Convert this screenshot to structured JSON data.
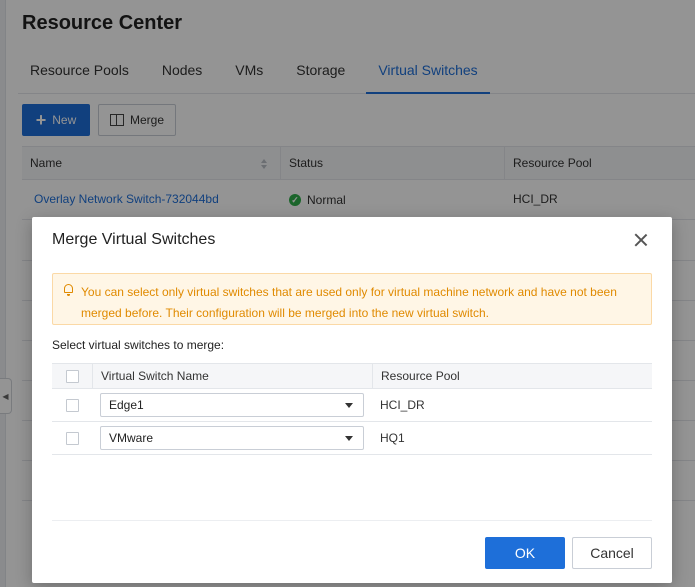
{
  "page": {
    "title": "Resource Center",
    "tabs": [
      {
        "label": "Resource Pools",
        "active": false
      },
      {
        "label": "Nodes",
        "active": false
      },
      {
        "label": "VMs",
        "active": false
      },
      {
        "label": "Storage",
        "active": false
      },
      {
        "label": "Virtual Switches",
        "active": true
      }
    ],
    "toolbar": {
      "new_label": "New",
      "merge_label": "Merge"
    },
    "table": {
      "columns": [
        "Name",
        "Status",
        "Resource Pool"
      ],
      "rows": [
        {
          "name": "Overlay Network Switch-732044bd",
          "status": "Normal",
          "pool": "HCI_DR"
        }
      ]
    }
  },
  "dialog": {
    "title": "Merge Virtual Switches",
    "notice": "You can select only virtual switches that are used only for virtual machine network and have not been merged before. Their configuration will be merged into the new virtual switch.",
    "select_label": "Select virtual switches to merge:",
    "columns": [
      "Virtual Switch Name",
      "Resource Pool"
    ],
    "rows": [
      {
        "switch": "Edge1",
        "pool": "HCI_DR",
        "checked": false
      },
      {
        "switch": "VMware",
        "pool": "HQ1",
        "checked": false
      }
    ],
    "ok_label": "OK",
    "cancel_label": "Cancel"
  },
  "colors": {
    "accent": "#1e6fd9",
    "warning_text": "#e08a00",
    "warning_bg": "#fff6e6",
    "status_ok": "#2fae4a"
  }
}
